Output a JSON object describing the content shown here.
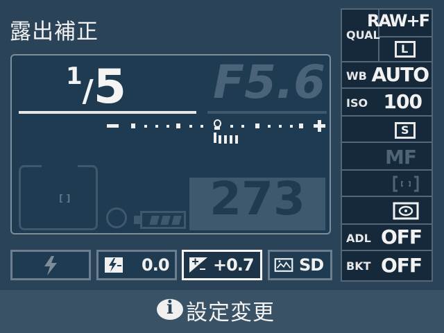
{
  "header": {
    "title": "露出補正"
  },
  "exposure": {
    "shutter_numerator": "1",
    "shutter_slash": "/",
    "shutter_denominator": "5",
    "aperture": "F5.6"
  },
  "meter": {
    "minus": "−",
    "plus": "+",
    "compensation_steps": 0.7
  },
  "af_area": {
    "point": "[ ]"
  },
  "battery": {
    "level_bars": 3
  },
  "shots_remaining": "273",
  "bottom_row": {
    "flash_mode_icon": "lightning-bolt-icon",
    "flash_comp_icon": "flash-compensation-icon",
    "flash_comp_value": "0.0",
    "exposure_comp_icon": "exposure-compensation-icon",
    "exposure_comp_value": "+0.7",
    "picture_control_icon": "picture-control-icon",
    "picture_control_value": "SD"
  },
  "right_panel": {
    "qual_label": "QUAL",
    "qual_value": "RAW+F",
    "image_size_value": "L",
    "wb_label": "WB",
    "wb_value": "AUTO",
    "iso_label": "ISO",
    "iso_value": "100",
    "af_mode_value": "S",
    "focus_mode_value": "MF",
    "af_area_icon": "af-area-icon",
    "metering_icon": "matrix-metering-icon",
    "adl_label": "ADL",
    "adl_value": "OFF",
    "bkt_label": "BKT",
    "bkt_value": "OFF"
  },
  "footer": {
    "info_icon": "info-button-icon",
    "info_letter": "i",
    "action_label": "設定変更"
  },
  "colors": {
    "background": "#2a4358",
    "panel": "#1f3b52",
    "dim": "#3e586d",
    "text": "#f2f2f2"
  }
}
